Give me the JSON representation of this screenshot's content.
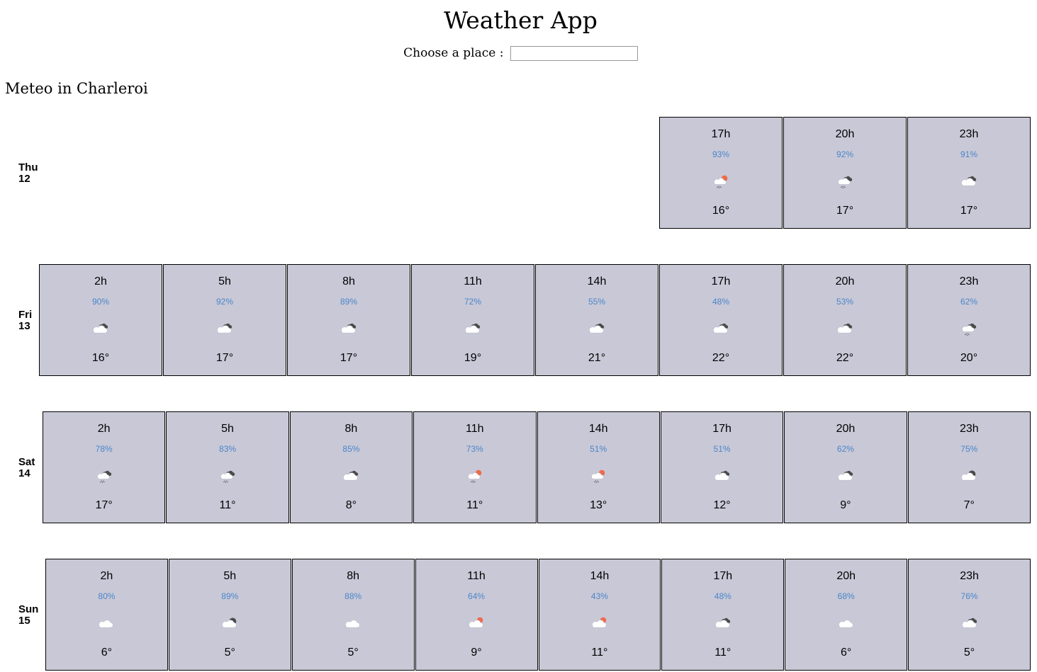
{
  "app": {
    "title": "Weather App"
  },
  "search": {
    "label": "Choose a place :",
    "value": "",
    "placeholder": ""
  },
  "location": {
    "heading": "Meteo in Charleroi"
  },
  "colors": {
    "card_bg": "#c9c8d7",
    "humidity_text": "#4a86c8",
    "sun": "#ee6b4d",
    "dark_cloud": "#4a4a4a",
    "light_cloud": "#ffffff"
  },
  "days": [
    {
      "name": "Thu",
      "date": "12",
      "slots": [
        {
          "hour": "17h",
          "humidity": "93%",
          "icon": "rain-sun",
          "temp": "16°"
        },
        {
          "hour": "20h",
          "humidity": "92%",
          "icon": "rain-cloud",
          "temp": "17°"
        },
        {
          "hour": "23h",
          "humidity": "91%",
          "icon": "cloudy",
          "temp": "17°"
        }
      ]
    },
    {
      "name": "Fri",
      "date": "13",
      "slots": [
        {
          "hour": "2h",
          "humidity": "90%",
          "icon": "cloudy",
          "temp": "16°"
        },
        {
          "hour": "5h",
          "humidity": "92%",
          "icon": "cloudy",
          "temp": "17°"
        },
        {
          "hour": "8h",
          "humidity": "89%",
          "icon": "cloudy",
          "temp": "17°"
        },
        {
          "hour": "11h",
          "humidity": "72%",
          "icon": "cloudy",
          "temp": "19°"
        },
        {
          "hour": "14h",
          "humidity": "55%",
          "icon": "cloudy",
          "temp": "21°"
        },
        {
          "hour": "17h",
          "humidity": "48%",
          "icon": "cloudy",
          "temp": "22°"
        },
        {
          "hour": "20h",
          "humidity": "53%",
          "icon": "cloudy",
          "temp": "22°"
        },
        {
          "hour": "23h",
          "humidity": "62%",
          "icon": "rain-cloud",
          "temp": "20°"
        }
      ]
    },
    {
      "name": "Sat",
      "date": "14",
      "slots": [
        {
          "hour": "2h",
          "humidity": "78%",
          "icon": "rain-cloud",
          "temp": "17°"
        },
        {
          "hour": "5h",
          "humidity": "83%",
          "icon": "rain-cloud",
          "temp": "11°"
        },
        {
          "hour": "8h",
          "humidity": "85%",
          "icon": "cloudy",
          "temp": "8°"
        },
        {
          "hour": "11h",
          "humidity": "73%",
          "icon": "rain-sun",
          "temp": "11°"
        },
        {
          "hour": "14h",
          "humidity": "51%",
          "icon": "rain-sun",
          "temp": "13°"
        },
        {
          "hour": "17h",
          "humidity": "51%",
          "icon": "cloudy",
          "temp": "12°"
        },
        {
          "hour": "20h",
          "humidity": "62%",
          "icon": "cloudy",
          "temp": "9°"
        },
        {
          "hour": "23h",
          "humidity": "75%",
          "icon": "partly-cloudy-night",
          "temp": "7°"
        }
      ]
    },
    {
      "name": "Sun",
      "date": "15",
      "slots": [
        {
          "hour": "2h",
          "humidity": "80%",
          "icon": "cloud",
          "temp": "6°"
        },
        {
          "hour": "5h",
          "humidity": "89%",
          "icon": "partly-cloudy-night",
          "temp": "5°"
        },
        {
          "hour": "8h",
          "humidity": "88%",
          "icon": "cloud",
          "temp": "5°"
        },
        {
          "hour": "11h",
          "humidity": "64%",
          "icon": "partly-cloudy-day",
          "temp": "9°"
        },
        {
          "hour": "14h",
          "humidity": "43%",
          "icon": "partly-cloudy-day",
          "temp": "11°"
        },
        {
          "hour": "17h",
          "humidity": "48%",
          "icon": "cloudy",
          "temp": "11°"
        },
        {
          "hour": "20h",
          "humidity": "68%",
          "icon": "cloud",
          "temp": "6°"
        },
        {
          "hour": "23h",
          "humidity": "76%",
          "icon": "cloudy",
          "temp": "5°"
        }
      ]
    }
  ]
}
